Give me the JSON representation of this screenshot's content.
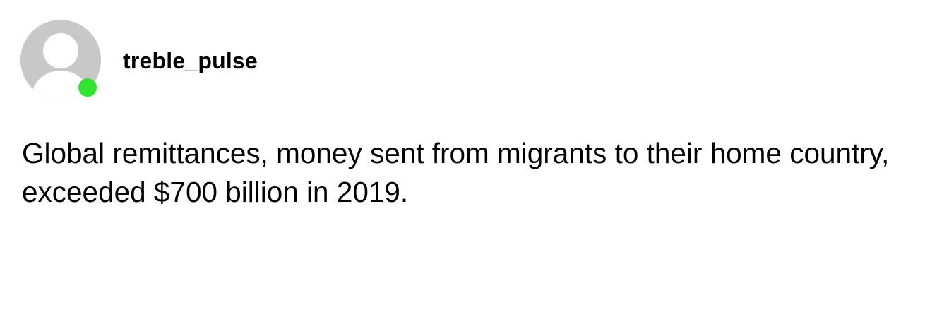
{
  "post": {
    "author": {
      "username": "treble_pulse",
      "avatar_icon": "default-user-avatar-icon",
      "online_status": "online",
      "status_color": "#2ee62e"
    },
    "text": "Global remittances, money sent from migrants to their home country, exceeded $700 billion in 2019."
  },
  "colors": {
    "background": "#ffffff",
    "avatar_background": "#c8c8c8",
    "avatar_silhouette": "#ffffff",
    "text": "#000000"
  }
}
